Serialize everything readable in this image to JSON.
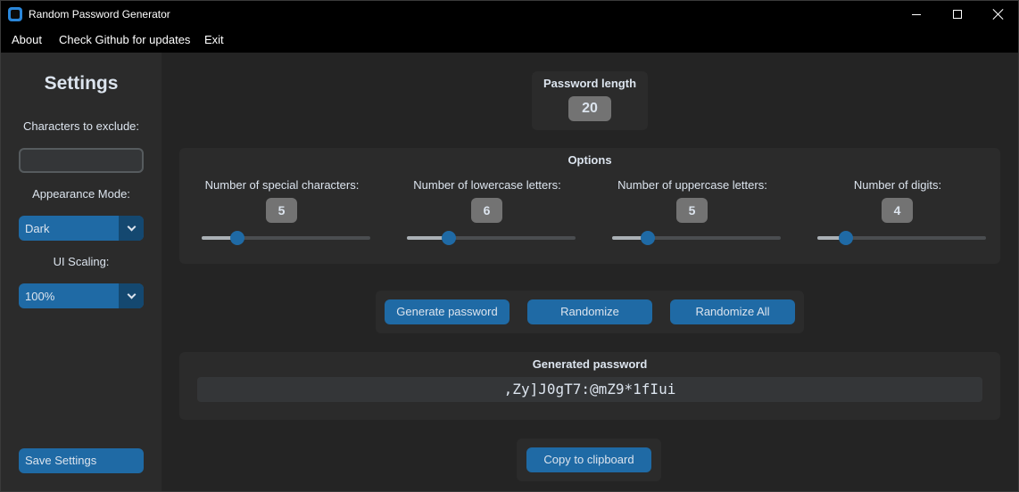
{
  "window": {
    "title": "Random Password Generator",
    "icon": "app-icon",
    "controls": [
      "minimize-icon",
      "maximize-icon",
      "close-icon"
    ]
  },
  "menu": {
    "about": "About",
    "github": "Check Github for updates",
    "exit": "Exit"
  },
  "sidebar": {
    "title": "Settings",
    "exclude_label": "Characters to exclude:",
    "exclude_value": "",
    "appearance_label": "Appearance Mode:",
    "appearance_value": "Dark",
    "scaling_label": "UI Scaling:",
    "scaling_value": "100%",
    "save_label": "Save Settings"
  },
  "length": {
    "title": "Password length",
    "value": "20"
  },
  "options": {
    "title": "Options",
    "items": [
      {
        "label": "Number of special characters:",
        "value": "5",
        "slider_fraction": 0.21
      },
      {
        "label": "Number of lowercase letters:",
        "value": "6",
        "slider_fraction": 0.25
      },
      {
        "label": "Number of uppercase letters:",
        "value": "5",
        "slider_fraction": 0.21
      },
      {
        "label": "Number of digits:",
        "value": "4",
        "slider_fraction": 0.17
      }
    ]
  },
  "actions": {
    "generate": "Generate password",
    "randomize": "Randomize",
    "randomize_all": "Randomize All"
  },
  "result": {
    "title": "Generated password",
    "password": ",Zy]J0gT7:@mZ9*1fIui"
  },
  "copy": {
    "label": "Copy to clipboard"
  },
  "colors": {
    "accent": "#1f6aa5",
    "accent_dark": "#144870",
    "background": "#242424",
    "panel": "#2b2b2b",
    "badge": "#737373"
  }
}
